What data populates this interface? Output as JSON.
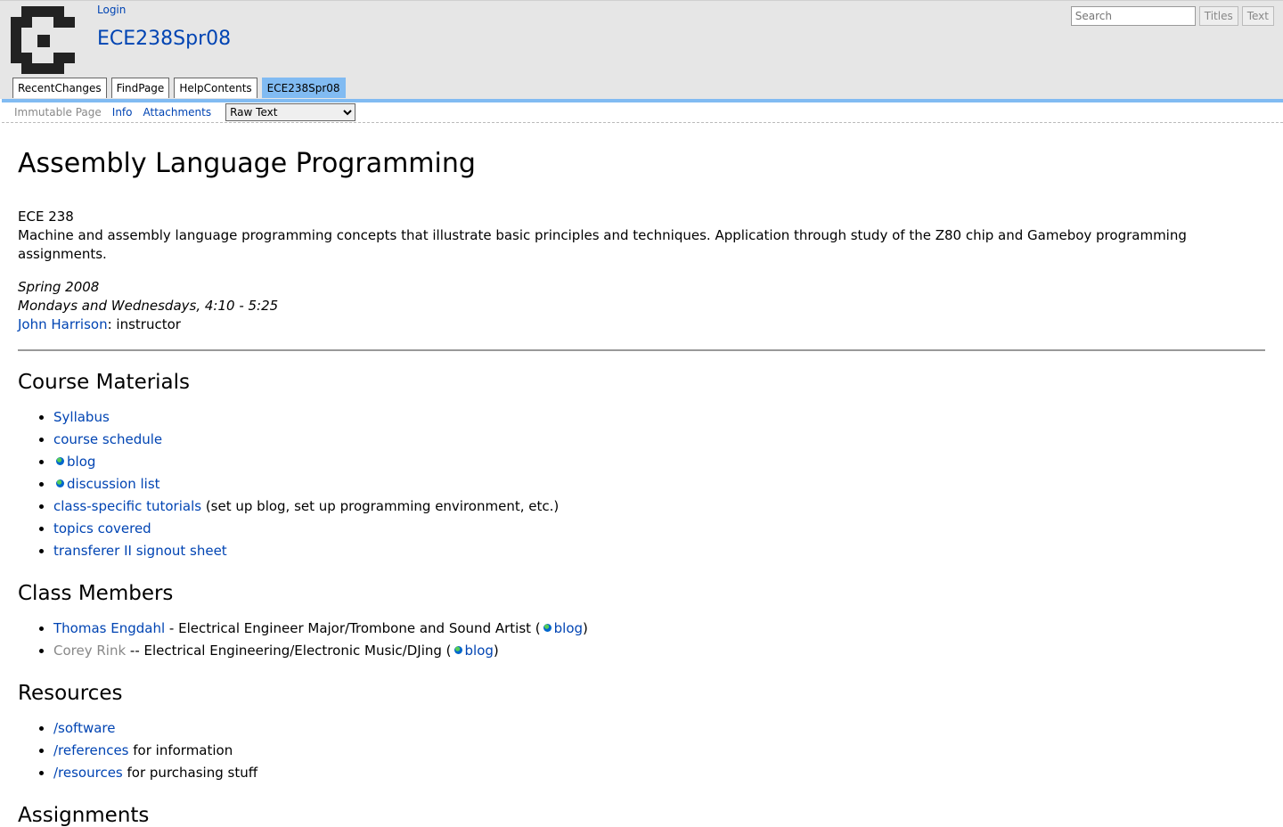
{
  "header": {
    "login": "Login",
    "page_name": "ECE238Spr08",
    "search_placeholder": "Search",
    "titles_button": "Titles",
    "text_button": "Text"
  },
  "navibar": [
    {
      "label": "RecentChanges"
    },
    {
      "label": "FindPage"
    },
    {
      "label": "HelpContents"
    },
    {
      "label": "ECE238Spr08"
    }
  ],
  "pagetrail": {
    "immutable": "Immutable Page",
    "info": "Info",
    "attachments": "Attachments",
    "select_value": "Raw Text"
  },
  "content": {
    "title": "Assembly Language Programming",
    "course_code": "ECE 238",
    "description": "Machine and assembly language programming concepts that illustrate basic principles and techniques. Application through study of the Z80 chip and Gameboy programming assignments.",
    "term": "Spring 2008",
    "schedule": "Mondays and Wednesdays, 4:10 - 5:25",
    "instructor_name": "John Harrison",
    "instructor_role": ": instructor",
    "materials_heading": "Course Materials",
    "materials": {
      "syllabus": "Syllabus",
      "schedule": "course schedule",
      "blog": "blog",
      "discussion": "discussion list",
      "tutorials": "class-specific tutorials",
      "tutorials_note": " (set up blog, set up programming environment, etc.)",
      "topics": "topics covered",
      "transferer": "transferer II signout sheet"
    },
    "members_heading": "Class Members",
    "members": [
      {
        "name": "Thomas Engdahl",
        "sep": " - ",
        "desc": "Electrical Engineer Major/Trombone and Sound Artist (",
        "blog": "blog",
        "close": ")"
      },
      {
        "name": "Corey Rink",
        "sep": " -- ",
        "desc": "Electrical Engineering/Electronic Music/DJing (",
        "blog": "blog",
        "close": ")"
      }
    ],
    "resources_heading": "Resources",
    "resources": [
      {
        "link": "/software",
        "note": ""
      },
      {
        "link": "/references",
        "note": " for information"
      },
      {
        "link": "/resources",
        "note": " for purchasing stuff"
      }
    ],
    "assignments_heading": "Assignments"
  }
}
